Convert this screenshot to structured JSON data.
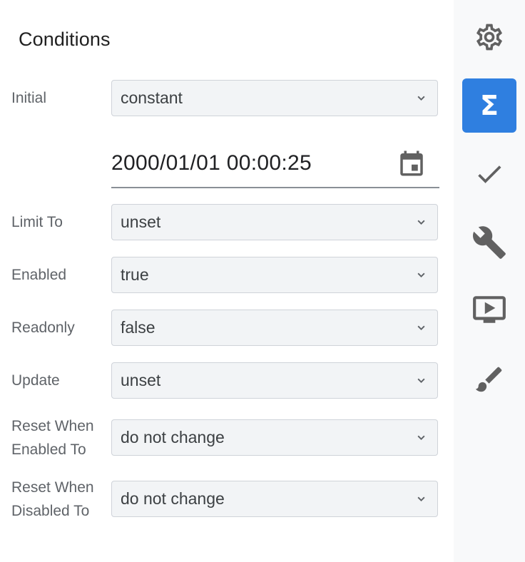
{
  "panel": {
    "title": "Conditions"
  },
  "fields": {
    "initial": {
      "label": "Initial",
      "value": "constant"
    },
    "datetime": {
      "value": "2000/01/01 00:00:25"
    },
    "limit_to": {
      "label": "Limit To",
      "value": "unset"
    },
    "enabled": {
      "label": "Enabled",
      "value": "true"
    },
    "readonly": {
      "label": "Readonly",
      "value": "false"
    },
    "update": {
      "label": "Update",
      "value": "unset"
    },
    "reset_when_enabled": {
      "label_line1": "Reset When",
      "label_line2": "Enabled To",
      "value": "do not change"
    },
    "reset_when_disabled": {
      "label_line1": "Reset When",
      "label_line2": "Disabled To",
      "value": "do not change"
    }
  },
  "rail": {
    "items": [
      {
        "icon": "gear-icon",
        "active": false
      },
      {
        "icon": "sigma-icon",
        "active": true
      },
      {
        "icon": "check-icon",
        "active": false
      },
      {
        "icon": "wrench-icon",
        "active": false
      },
      {
        "icon": "presentation-icon",
        "active": false
      },
      {
        "icon": "brush-icon",
        "active": false
      }
    ],
    "active_color": "#2f7fe0",
    "icon_color": "#616161"
  }
}
